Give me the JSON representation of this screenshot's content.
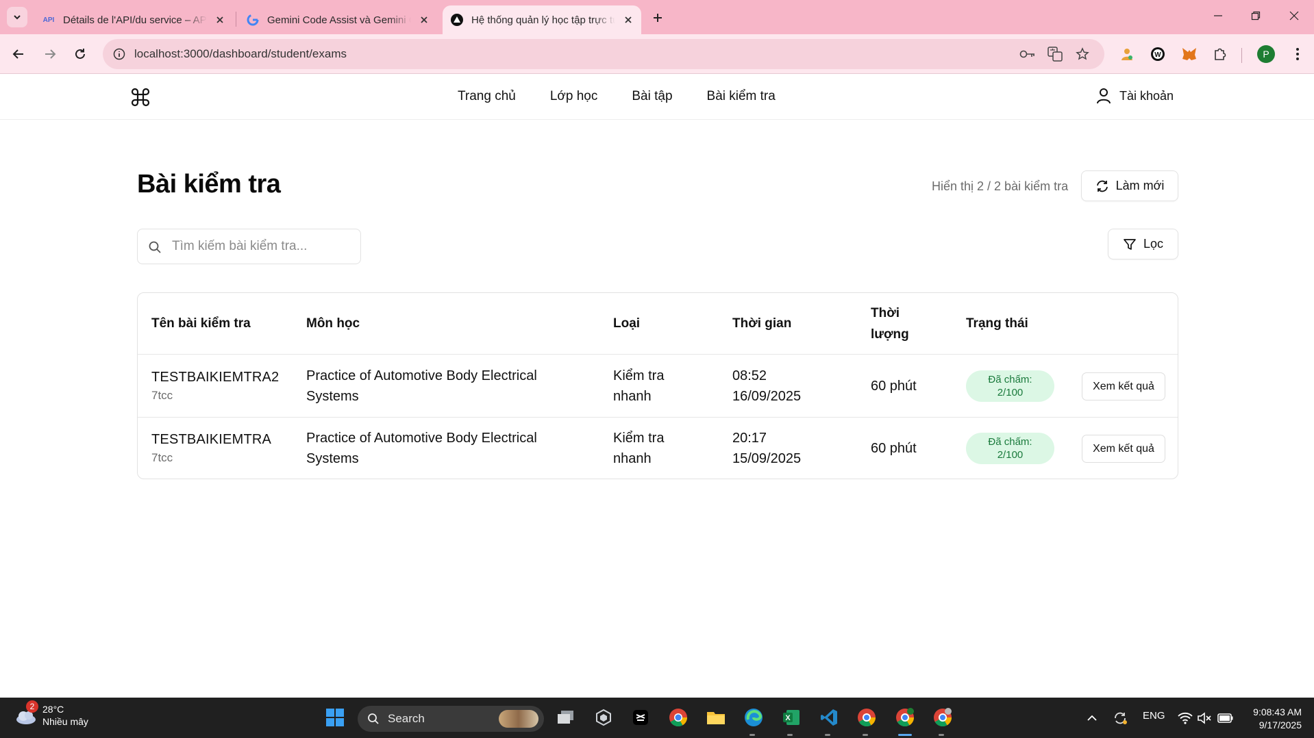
{
  "browser": {
    "tabs": [
      {
        "favicon": "API",
        "title": "Détails de l'API/du service – API",
        "active": false
      },
      {
        "favicon": "google-g",
        "title": "Gemini Code Assist và Gemini C",
        "active": false
      },
      {
        "favicon": "triangle-logo",
        "title": "Hệ thống quản lý học tập trực tuyến",
        "active": true
      }
    ],
    "url": "localhost:3000/dashboard/student/exams",
    "profile_initial": "P"
  },
  "header": {
    "nav": [
      "Trang chủ",
      "Lớp học",
      "Bài tập",
      "Bài kiểm tra"
    ],
    "account_label": "Tài khoản"
  },
  "page": {
    "title": "Bài kiểm tra",
    "count_text": "Hiển thị 2 / 2 bài kiểm tra",
    "refresh_label": "Làm mới",
    "filter_label": "Lọc",
    "search_placeholder": "Tìm kiếm bài kiểm tra..."
  },
  "table": {
    "headers": {
      "name": "Tên bài kiểm tra",
      "subject": "Môn học",
      "type": "Loại",
      "time": "Thời gian",
      "duration_l1": "Thời",
      "duration_l2": "lượng",
      "status": "Trạng thái"
    },
    "rows": [
      {
        "name": "TESTBAIKIEMTRA2",
        "code": "7tcc",
        "subject_l1": "Practice of Automotive Body Electrical",
        "subject_l2": "Systems",
        "type_l1": "Kiểm tra",
        "type_l2": "nhanh",
        "time_l1": "08:52",
        "time_l2": "16/09/2025",
        "duration": "60 phút",
        "status_l1": "Đã chấm:",
        "status_l2": "2/100",
        "action": "Xem kết quả"
      },
      {
        "name": "TESTBAIKIEMTRA",
        "code": "7tcc",
        "subject_l1": "Practice of Automotive Body Electrical",
        "subject_l2": "Systems",
        "type_l1": "Kiểm tra",
        "type_l2": "nhanh",
        "time_l1": "20:17",
        "time_l2": "15/09/2025",
        "duration": "60 phút",
        "status_l1": "Đã chấm:",
        "status_l2": "2/100",
        "action": "Xem kết quả"
      }
    ]
  },
  "taskbar": {
    "weather_temp": "28°C",
    "weather_desc": "Nhiều mây",
    "weather_badge": "2",
    "search_label": "Search",
    "language": "ENG",
    "time": "9:08:43 AM",
    "date": "9/17/2025"
  },
  "colors": {
    "tabbar": "#f7b6c8",
    "toolbar": "#fde7ee",
    "badge_bg": "#dcf7e5",
    "badge_text": "#1a7a3c",
    "taskbar": "#202020"
  }
}
